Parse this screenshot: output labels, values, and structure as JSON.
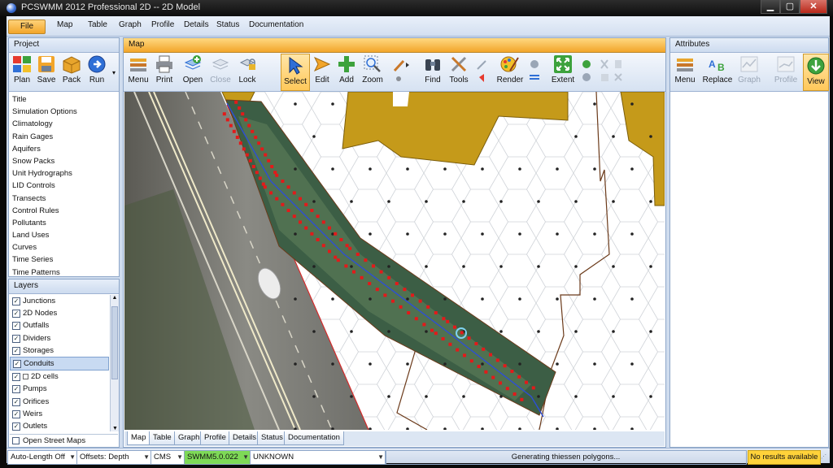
{
  "window": {
    "title": "PCSWMM 2012 Professional 2D -- 2D Model"
  },
  "menubar": {
    "items": [
      "File",
      "Map",
      "Table",
      "Graph",
      "Profile",
      "Details",
      "Status",
      "Documentation"
    ]
  },
  "project_panel": {
    "title": "Project",
    "toolbar": [
      "Plan",
      "Save",
      "Pack",
      "Run"
    ],
    "items": [
      "Title",
      "Simulation Options",
      "Climatology",
      "Rain Gages",
      "Aquifers",
      "Snow Packs",
      "Unit Hydrographs",
      "LID Controls",
      "Transects",
      "Control Rules",
      "Pollutants",
      "Land Uses",
      "Curves",
      "Time Series",
      "Time Patterns"
    ]
  },
  "layers_panel": {
    "title": "Layers",
    "items": [
      {
        "label": "Junctions",
        "checked": true
      },
      {
        "label": "2D Nodes",
        "checked": true
      },
      {
        "label": "Outfalls",
        "checked": true
      },
      {
        "label": "Dividers",
        "checked": true
      },
      {
        "label": "Storages",
        "checked": true
      },
      {
        "label": "Conduits",
        "checked": true,
        "selected": true
      },
      {
        "label": "2D cells",
        "checked": true
      },
      {
        "label": "Pumps",
        "checked": true
      },
      {
        "label": "Orifices",
        "checked": true
      },
      {
        "label": "Weirs",
        "checked": true
      },
      {
        "label": "Outlets",
        "checked": true
      }
    ],
    "open_street_maps": "Open Street Maps"
  },
  "map_panel": {
    "title": "Map",
    "toolbar": [
      "Menu",
      "Print",
      "Open",
      "Close",
      "Lock",
      "Select",
      "Edit",
      "Add",
      "Zoom",
      "Find",
      "Tools",
      "Render",
      "Extent"
    ],
    "tabs": [
      "Map",
      "Table",
      "Graph",
      "Profile",
      "Details",
      "Status",
      "Documentation"
    ]
  },
  "attributes_panel": {
    "title": "Attributes",
    "toolbar": [
      "Menu",
      "Replace",
      "Graph",
      "Profile",
      "View"
    ]
  },
  "statusbar": {
    "auto_length": "Auto-Length Off",
    "offsets": "Offsets: Depth",
    "units": "CMS",
    "engine": "SWMM5.0.022",
    "crs": "UNKNOWN",
    "message": "Generating thiessen polygons...",
    "results": "No results available"
  },
  "colors": {
    "accent": "#f2a52a",
    "panel_border": "#8ea7c9",
    "buildings": "#c59a1a",
    "conduit": "#2d4fd6",
    "junction": "#e31a1a"
  }
}
